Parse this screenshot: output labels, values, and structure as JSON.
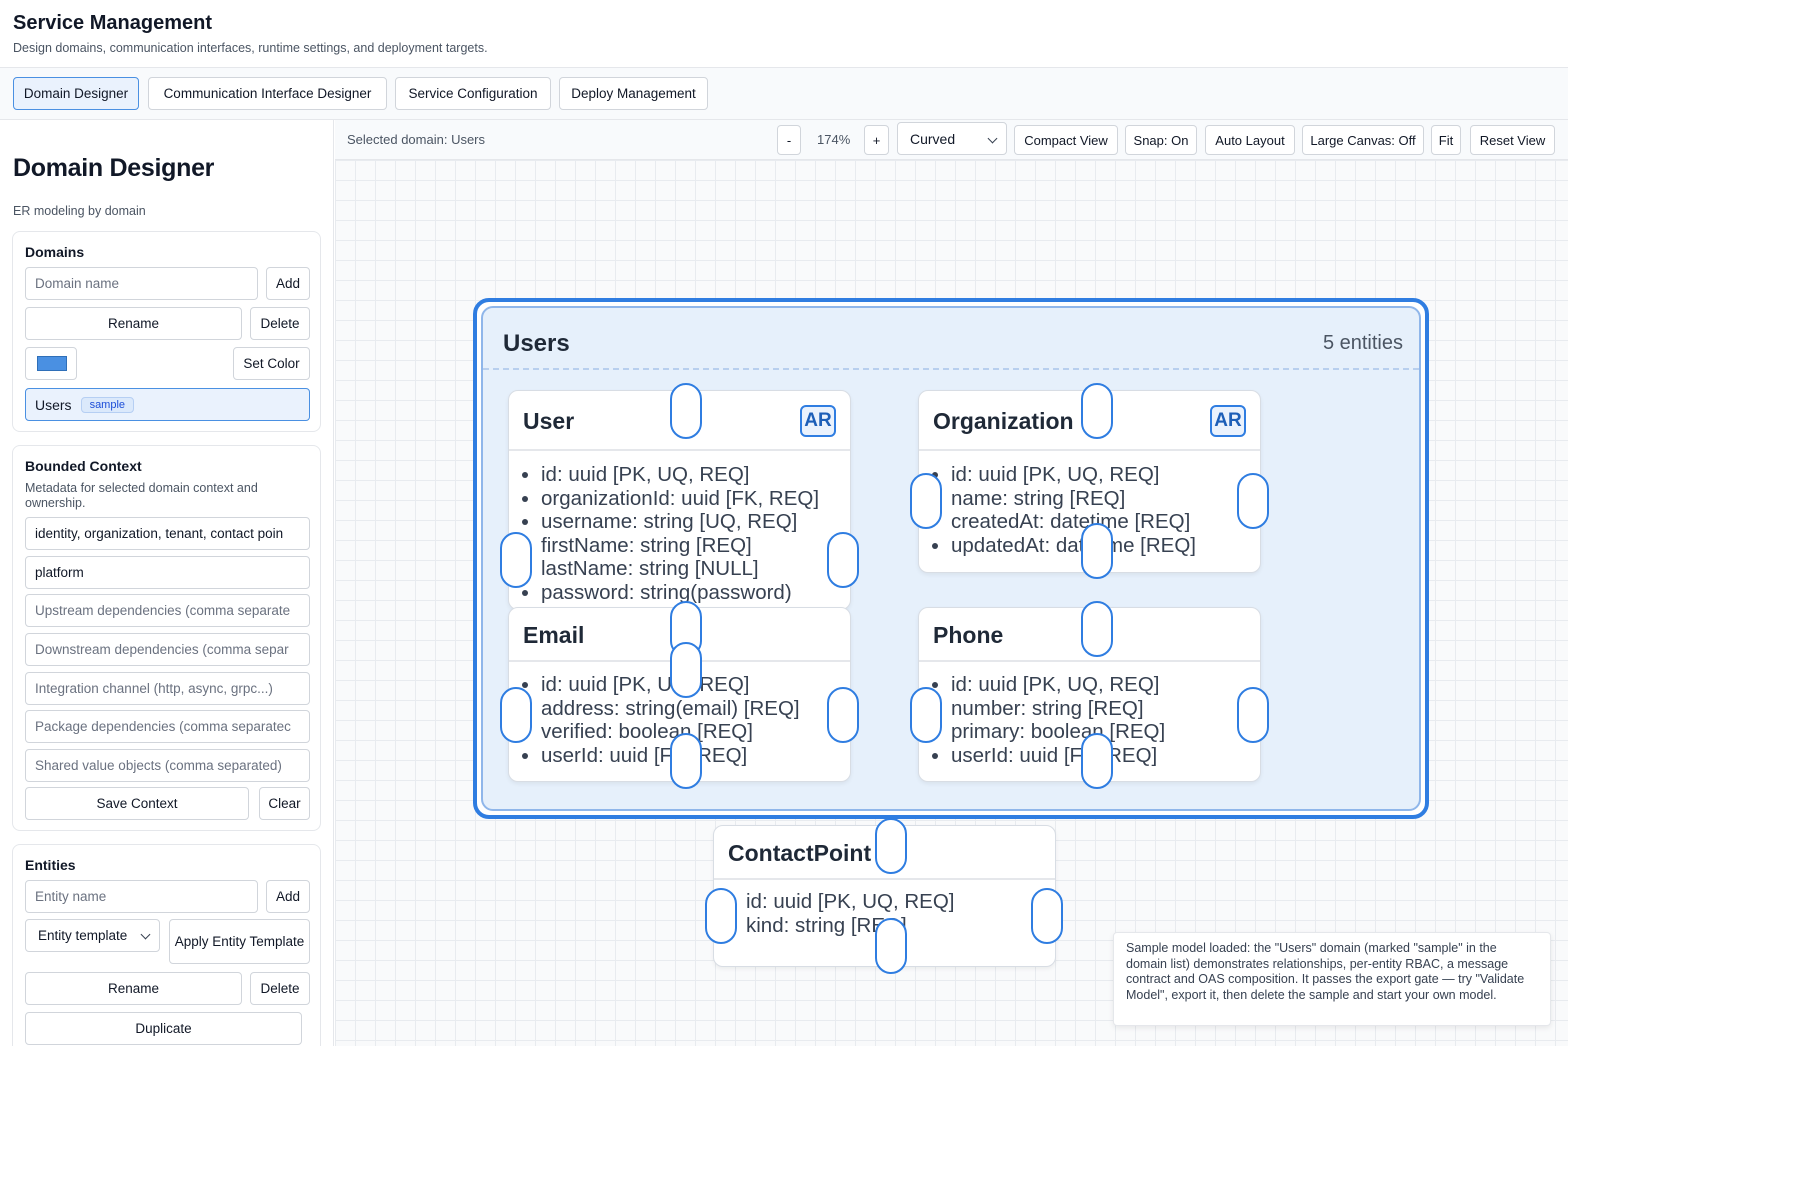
{
  "header": {
    "title": "Service Management",
    "subtitle": "Design domains, communication interfaces, runtime settings, and deployment targets."
  },
  "tabs": [
    {
      "label": "Domain Designer",
      "active": true
    },
    {
      "label": "Communication Interface Designer",
      "active": false
    },
    {
      "label": "Service Configuration",
      "active": false
    },
    {
      "label": "Deploy Management",
      "active": false
    }
  ],
  "sidebar": {
    "title": "Domain Designer",
    "subtitle": "ER modeling by domain",
    "domains": {
      "title": "Domains",
      "name_placeholder": "Domain name",
      "add_label": "Add",
      "rename_label": "Rename",
      "delete_label": "Delete",
      "set_color_label": "Set Color",
      "color": "#4a90e2",
      "items": [
        {
          "name": "Users",
          "badge": "sample"
        }
      ]
    },
    "bounded_context": {
      "title": "Bounded Context",
      "description": "Metadata for selected domain context and ownership.",
      "fields": {
        "context_value": "identity, organization, tenant, contact poin",
        "owner_value": "platform",
        "upstream_placeholder": "Upstream dependencies (comma separate",
        "downstream_placeholder": "Downstream dependencies (comma separ",
        "integration_placeholder": "Integration channel (http, async, grpc...)",
        "package_placeholder": "Package dependencies (comma separatec",
        "shared_placeholder": "Shared value objects (comma separated)"
      },
      "save_label": "Save Context",
      "clear_label": "Clear"
    },
    "entities": {
      "title": "Entities",
      "name_placeholder": "Entity name",
      "add_label": "Add",
      "template_label": "Entity template",
      "apply_template_label": "Apply Entity Template",
      "rename_label": "Rename",
      "delete_label": "Delete",
      "duplicate_label": "Duplicate"
    }
  },
  "toolbar": {
    "selected_domain": "Selected domain: Users",
    "zoom_out": "-",
    "zoom_level": "174%",
    "zoom_in": "+",
    "edge_style": "Curved",
    "compact_view": "Compact View",
    "snap": "Snap: On",
    "auto_layout": "Auto Layout",
    "large_canvas": "Large Canvas: Off",
    "fit": "Fit",
    "reset_view": "Reset View"
  },
  "canvas": {
    "domain": {
      "name": "Users",
      "count": "5 entities",
      "color": "#2f7de1"
    },
    "entities": {
      "user": {
        "name": "User",
        "badge": "AR",
        "fields": [
          "id: uuid [PK, UQ, REQ]",
          "organizationId: uuid [FK, REQ]",
          "username: string [UQ, REQ]",
          "firstName: string [REQ]",
          "lastName: string [NULL]",
          "password: string(password)"
        ]
      },
      "organization": {
        "name": "Organization",
        "badge": "AR",
        "fields": [
          "id: uuid [PK, UQ, REQ]",
          "name: string [REQ]",
          "createdAt: datetime [REQ]",
          "updatedAt: datetime [REQ]"
        ]
      },
      "email": {
        "name": "Email",
        "fields": [
          "id: uuid [PK, UQ, REQ]",
          "address: string(email) [REQ]",
          "verified: boolean [REQ]",
          "userId: uuid [FK, REQ]"
        ]
      },
      "phone": {
        "name": "Phone",
        "fields": [
          "id: uuid [PK, UQ, REQ]",
          "number: string [REQ]",
          "primary: boolean [REQ]",
          "userId: uuid [FK, REQ]"
        ]
      },
      "contactpoint": {
        "name": "ContactPoint",
        "fields": [
          "id: uuid [PK, UQ, REQ]",
          "kind: string [REQ]"
        ]
      }
    }
  },
  "notice": "Sample model loaded: the \"Users\" domain (marked \"sample\" in the domain list) demonstrates relationships, per-entity RBAC, a message contract and OAS composition. It passes the export gate — try \"Validate Model\", export it, then delete the sample and start your own model."
}
